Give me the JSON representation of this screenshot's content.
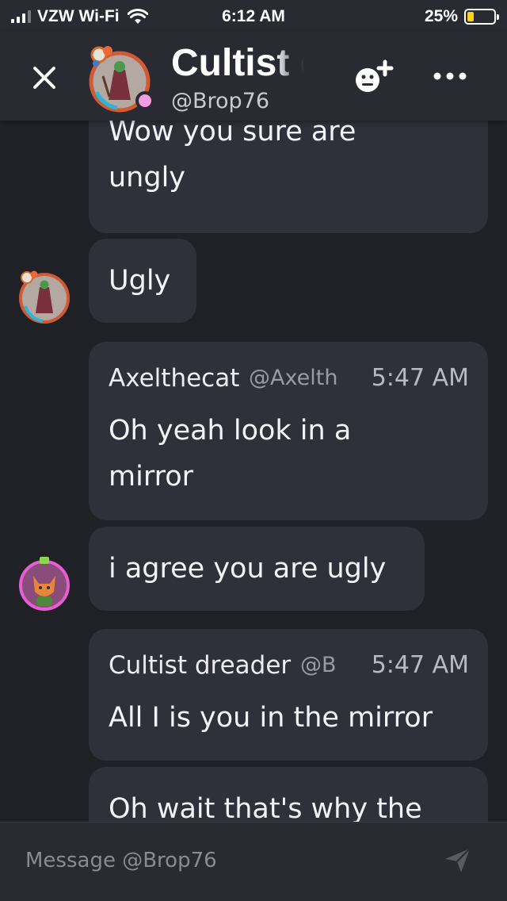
{
  "status_bar": {
    "carrier": "VZW Wi-Fi",
    "time": "6:12 AM",
    "battery_percent": "25%",
    "battery_level": 0.25,
    "signal_bars": 3,
    "signal_bars_total": 4
  },
  "header": {
    "name": "Cultist dreader",
    "handle": "@Brop76",
    "presence_color": "#f39ce2",
    "close_icon": "close-icon",
    "add_friend_icon": "add-friend-icon",
    "more_icon": "more-icon"
  },
  "messages": [
    {
      "text_lines": [
        "Wow you sure are",
        "ungly"
      ]
    },
    {
      "text_lines": [
        "Ugly"
      ]
    },
    {
      "author": "Axelthecat",
      "handle": "@Axelth",
      "time": "5:47 AM",
      "text_lines": [
        "Oh yeah look in a",
        "mirror"
      ]
    },
    {
      "text_lines": [
        "i agree you are ugly"
      ]
    },
    {
      "author": "Cultist dreader",
      "handle": "@B",
      "time": "5:47 AM",
      "text_lines": [
        "All I is you in the mirror"
      ]
    },
    {
      "text_lines": [
        "Oh wait that's why the"
      ]
    }
  ],
  "composer": {
    "placeholder": "Message @Brop76",
    "send_icon": "send-icon"
  },
  "colors": {
    "background": "#202027",
    "bubble": "#30303a",
    "header": "#2a2a33",
    "battery": "#f6d31b"
  }
}
